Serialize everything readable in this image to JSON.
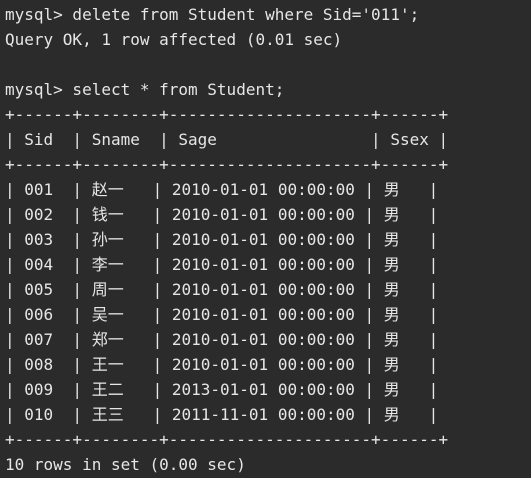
{
  "terminal": {
    "colors": {
      "background": "#2b2b2b",
      "text": "#e6e6e6"
    },
    "lines": [
      "mysql> delete from Student where Sid='011';",
      "Query OK, 1 row affected (0.01 sec)",
      "",
      "mysql> select * from Student;",
      "+------+--------+---------------------+------+",
      "| Sid  | Sname  | Sage                | Ssex |",
      "+------+--------+---------------------+------+",
      "| 001  | 赵一   | 2010-01-01 00:00:00 | 男   |",
      "| 002  | 钱一   | 2010-01-01 00:00:00 | 男   |",
      "| 003  | 孙一   | 2010-01-01 00:00:00 | 男   |",
      "| 004  | 李一   | 2010-01-01 00:00:00 | 男   |",
      "| 005  | 周一   | 2010-01-01 00:00:00 | 男   |",
      "| 006  | 吴一   | 2010-01-01 00:00:00 | 男   |",
      "| 007  | 郑一   | 2010-01-01 00:00:00 | 男   |",
      "| 008  | 王一   | 2010-01-01 00:00:00 | 男   |",
      "| 009  | 王二   | 2013-01-01 00:00:00 | 男   |",
      "| 010  | 王三   | 2011-11-01 00:00:00 | 男   |",
      "+------+--------+---------------------+------+",
      "10 rows in set (0.00 sec)"
    ]
  }
}
